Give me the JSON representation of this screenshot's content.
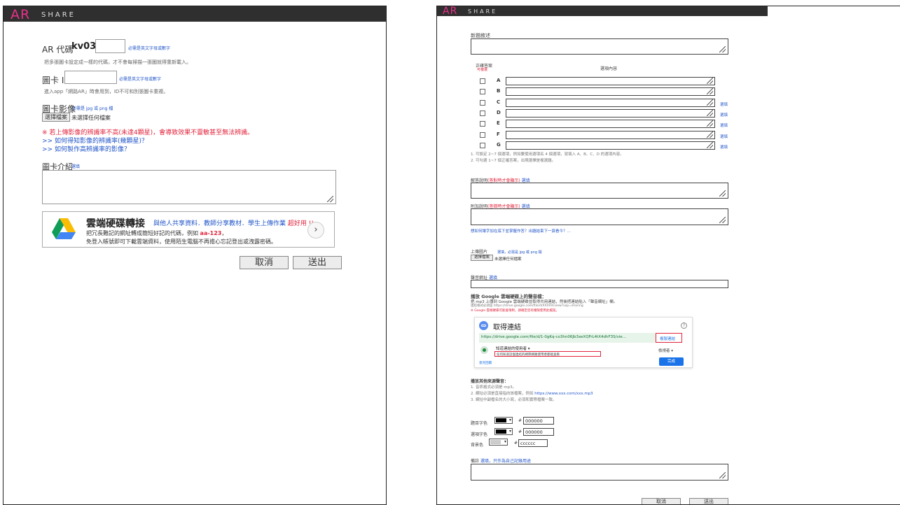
{
  "left": {
    "logo_ar": "AR",
    "logo_share": "SHARE",
    "ar_code_label": "AR 代碼",
    "ar_code_prefix": "kv03 -",
    "ar_code_hint": "必需是英文字母或數字",
    "ar_code_desc": "把多張圖卡設定成一樣的代碼，才不會每掃描一張圖就得重新載入。",
    "card_id_label": "圖卡 ID",
    "card_id_hint": "必需是英文字母或數字",
    "card_id_desc": "進入app「網路AR」時會用到，ID不可和別張圖卡重複。",
    "card_image_label": "圖卡影像",
    "card_image_hint": "必需是 jpg 或 png 檔",
    "choose_file_button": "選擇檔案",
    "no_file_text": "未選擇任何檔案",
    "warning_text": "※ 若上傳影像的辨識率不高(未達4顆星)，會導致效果不靈敏甚至無法辨識。",
    "link_rating": ">> 如何得知影像的辨識率(幾顆星)？",
    "link_make_image": ">> 如何製作高辨識率的影像？",
    "card_intro_label": "圖卡介紹",
    "card_intro_optional": "選填",
    "promo_title": "雲端硬碟轉接",
    "promo_subtitle_a": "與他人共享資料．教師分享教材．學生上傳作業 ",
    "promo_subtitle_b": "超好用 !!",
    "promo_line1_a": "把冗長難記的網址轉成簡短好記的代碼，例如 ",
    "promo_line1_b": "aa-123",
    "promo_line1_c": "，",
    "promo_line2": "免登入帳號即可下載雲端資料，使用陌生電腦不再擔心忘記登出或洩露密碼。",
    "cancel_button": "取消",
    "submit_button": "送出"
  },
  "right": {
    "logo_ar": "AR",
    "logo_share": "SHARE",
    "question_label": "新題敘述",
    "correct_answer_label": "正確答案",
    "correct_answer_sub": "可複選",
    "option_content_label": "選項內容",
    "options": [
      "A",
      "B",
      "C",
      "D",
      "E",
      "F",
      "G"
    ],
    "option_optional_texts": [
      "",
      "",
      "選填",
      "選填",
      "選填",
      "選填",
      "選填"
    ],
    "option_note1": "1. 可設定 2~7 個選項，例如要使用選項名 4 個選項，就填入 A、B、C、D 的選項內容。",
    "option_note2": "2. 可勾選 1~7 個正確答案，出現選擇是複選題。",
    "answer_explain_label": "解答說明",
    "answer_explain_note": "(答對時才會顯示)",
    "answer_explain_optional": "選填",
    "wrong_explain_label": "附加說明",
    "wrong_explain_note": "(答錯時才會顯示)",
    "wrong_explain_optional": "選填",
    "explain_link": "想如何讓字加在底下並掌握作答？出題結束下一頁看今？...",
    "upload_image_label": "上傳圖片",
    "upload_image_hint": "選填，必需是 jpg 或 png 檔",
    "choose_file_button": "選擇檔案",
    "no_file_text": "未選擇任何檔案",
    "sound_url_label": "聲音網址",
    "sound_url_optional": "選填",
    "gdrive_title": "播放 Google 雲端硬碟上的聲音檔：",
    "gdrive_desc": "把 mp3 上傳到 Google 雲端硬碟並取得共用連結，然後把連結貼入「聲音網址」欄。",
    "gdrive_example": "連結格式必須是 https://drive.google.com/file/d/XXXXX/view?usp=sharing",
    "gdrive_warning": "※ Google 雲端硬碟可能會限制，請確定您有權限使用此檔案。",
    "share_dialog": {
      "title": "取得連結",
      "url": "https://drive.google.com/file/d/1-0gKq-co3hn06Jb3xeXQFrL4tX4dhF3S/vie...",
      "copy_link": "複製連結",
      "access_title": "知道連結的使用者 ▾",
      "access_desc": "任何知道這個連結的網際網路使用者都能查看",
      "viewer_role": "檢視者 ▾",
      "feedback_link": "意見回饋",
      "done_button": "完成"
    },
    "other_sound_title": "播放其他來源聲音：",
    "other_sound_1": "1. 音訊格式必須是 mp3。",
    "other_sound_2a": "2. 網址必須是直接指向該檔案，例如 ",
    "other_sound_2b": "https://www.xxx.com/xxx.mp3",
    "other_sound_3": "3. 網址中副檔名的大小寫，必須和實際檔案一致。",
    "question_color_label": "題目字色",
    "option_color_label": "選項字色",
    "bg_color_label": "背景色",
    "question_color_value": "000000",
    "option_color_value": "000000",
    "bg_color_value": "cccccc",
    "colors": {
      "question": "#000000",
      "option": "#000000",
      "background": "#cccccc"
    },
    "remark_label": "備註",
    "remark_optional": "選填，只作為自己記錄用途",
    "cancel_button": "取消",
    "submit_button": "送出"
  },
  "colors": {
    "brand_pink": "#e8308a",
    "link_blue": "#2155c9",
    "warning_red": "#e2243c",
    "topbar": "#2f2f2f"
  }
}
